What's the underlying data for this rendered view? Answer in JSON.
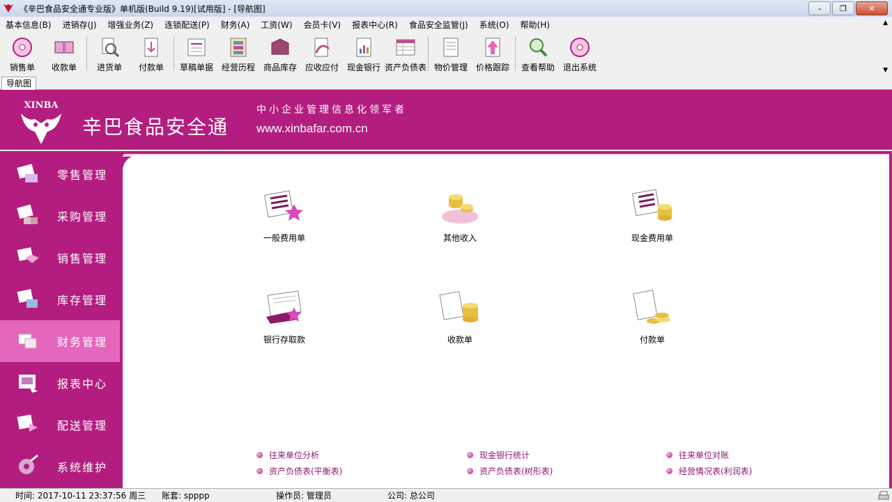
{
  "window": {
    "title": "《辛巴食品安全通专业版》单机版(Build 9.19)[试用版] - [导航图]",
    "minimize": "–",
    "restore": "❐",
    "close": "✕"
  },
  "menu": [
    "基本信息(B)",
    "进销存(J)",
    "增强业务(Z)",
    "连锁配送(P)",
    "财务(A)",
    "工资(W)",
    "会员卡(V)",
    "报表中心(R)",
    "食品安全监管(J)",
    "系统(O)",
    "帮助(H)"
  ],
  "toolbar": [
    {
      "label": "销售单",
      "icon": "sales-order-icon"
    },
    {
      "label": "收款单",
      "icon": "receipt-icon"
    },
    {
      "label": "进货单",
      "icon": "purchase-order-icon"
    },
    {
      "label": "付款单",
      "icon": "payment-icon"
    },
    {
      "label": "草稿单据",
      "icon": "draft-icon"
    },
    {
      "label": "经营历程",
      "icon": "history-icon"
    },
    {
      "label": "商品库存",
      "icon": "inventory-icon"
    },
    {
      "label": "应收应付",
      "icon": "receivable-icon"
    },
    {
      "label": "现金银行",
      "icon": "cash-bank-icon"
    },
    {
      "label": "资产负债表",
      "icon": "balance-sheet-icon"
    },
    {
      "label": "物价管理",
      "icon": "price-manage-icon"
    },
    {
      "label": "价格跟踪",
      "icon": "price-track-icon"
    },
    {
      "label": "查看帮助",
      "icon": "help-icon"
    },
    {
      "label": "退出系统",
      "icon": "exit-icon"
    }
  ],
  "tab": {
    "label": "导航图"
  },
  "banner": {
    "logo_text": "XINBA",
    "brand": "辛巴食品安全通",
    "slogan": "中小企业管理信息化领军者",
    "website": "www.xinbafar.com.cn"
  },
  "sidebar": [
    {
      "label": "零售管理",
      "icon": "retail-icon"
    },
    {
      "label": "采购管理",
      "icon": "procurement-icon"
    },
    {
      "label": "销售管理",
      "icon": "sales-icon"
    },
    {
      "label": "库存管理",
      "icon": "stock-icon"
    },
    {
      "label": "财务管理",
      "icon": "finance-icon",
      "active": true
    },
    {
      "label": "报表中心",
      "icon": "report-icon"
    },
    {
      "label": "配送管理",
      "icon": "delivery-icon"
    },
    {
      "label": "系统维护",
      "icon": "maintenance-icon"
    }
  ],
  "content": {
    "items": [
      {
        "label": "一般费用单",
        "icon": "general-expense-icon"
      },
      {
        "label": "其他收入",
        "icon": "other-income-icon"
      },
      {
        "label": "现金费用单",
        "icon": "cash-expense-icon"
      },
      {
        "label": "银行存取款",
        "icon": "bank-deposit-icon"
      },
      {
        "label": "收款单",
        "icon": "collection-icon"
      },
      {
        "label": "付款单",
        "icon": "payment-voucher-icon"
      }
    ],
    "links": [
      "往来单位分析",
      "现金银行统计",
      "往来单位对账",
      "资产负债表(平衡表)",
      "资产负债表(树形表)",
      "经营情况表(利润表)"
    ]
  },
  "status": {
    "time": "时间: 2017-10-11 23:37:56 周三",
    "account": "账套: spppp",
    "operator": "操作员: 管理员",
    "company": "公司: 总公司"
  },
  "colors": {
    "brand": "#b41d80",
    "active": "#e567bd",
    "link": "#8d1a6b"
  }
}
